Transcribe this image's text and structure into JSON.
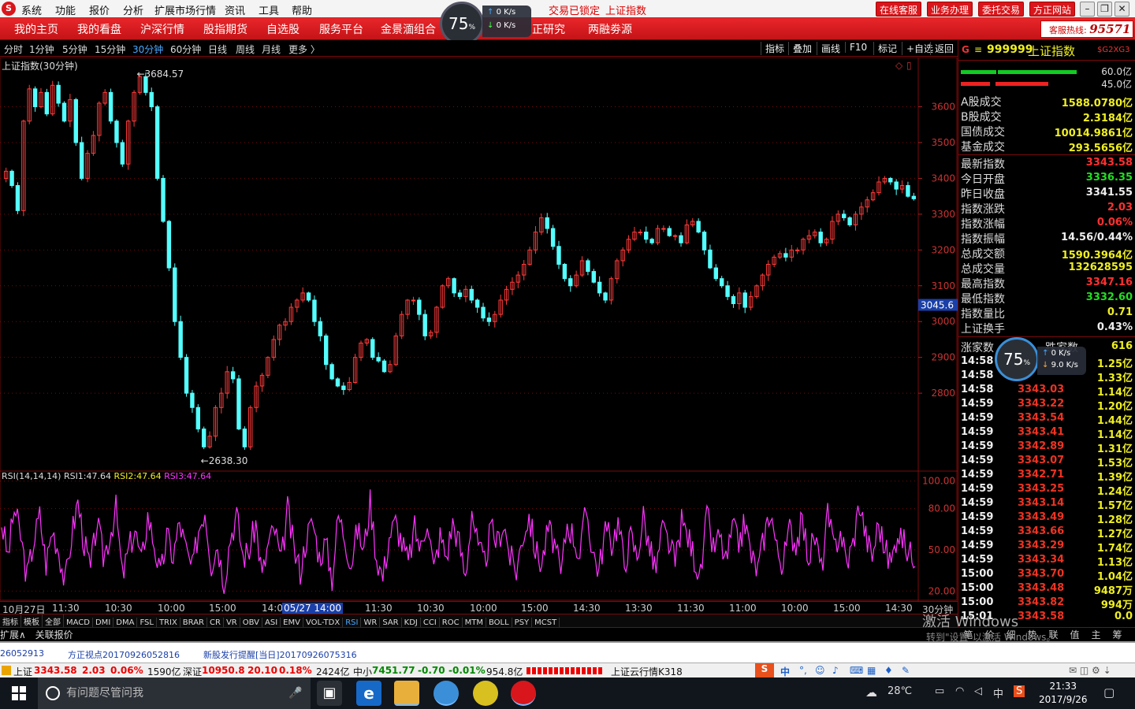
{
  "menubar": {
    "logo": "S",
    "items": [
      "系统",
      "功能",
      "报价",
      "分析",
      "扩展市场行情",
      "资讯",
      "工具",
      "帮助"
    ],
    "trade_lock": "交易已锁定",
    "current_index": "上证指数",
    "right_buttons": [
      "在线客服",
      "业务办理",
      "委托交易",
      "方正网站"
    ]
  },
  "gauge": {
    "percent": "75",
    "unit": "%",
    "up": "0 K/s",
    "down": "0 K/s"
  },
  "nav": {
    "items": [
      "我的主页",
      "我的看盘",
      "沪深行情",
      "股指期货",
      "自选股",
      "服务平台",
      "金景湎组合",
      "正研究",
      "两融劵源"
    ]
  },
  "hotline": {
    "label": "客服热线:",
    "number": "95571"
  },
  "periods": {
    "items": [
      "分时",
      "1分钟",
      "5分钟",
      "15分钟",
      "30分钟",
      "60分钟",
      "日线",
      "周线",
      "月线",
      "更多 〉"
    ],
    "active_index": 4,
    "tools": [
      "指标",
      "叠加",
      "画线",
      "F10",
      "标记",
      "+自选",
      "返回"
    ]
  },
  "chart_title": "上证指数(30分钟)",
  "chart_data": [
    {
      "type": "line",
      "name": "上证指数(30分钟)",
      "ylim": [
        2600,
        3720
      ],
      "yticks": [
        2800,
        2900,
        3000,
        3100,
        3200,
        3300,
        3400,
        3500,
        3600
      ],
      "annotations": {
        "high": "3684.57",
        "low": "2638.30",
        "cursor_price": "3045.6"
      },
      "series": [
        {
          "values": [
            3420,
            3380,
            3310,
            3560,
            3650,
            3600,
            3640,
            3580,
            3660,
            3610,
            3560,
            3620,
            3500,
            3400,
            3470,
            3520,
            3610,
            3640,
            3560,
            3500,
            3440,
            3560,
            3640,
            3684,
            3640,
            3600,
            3400,
            3280,
            3150,
            3000,
            2900,
            2800,
            2760,
            2700,
            2650,
            2680,
            2760,
            2800,
            2860,
            2840,
            2700,
            2650,
            2760,
            2820,
            2850,
            2900,
            2950,
            2990,
            3000,
            3040,
            3060,
            3080,
            3060,
            3000,
            2960,
            2880,
            2840,
            2820,
            2810,
            2830,
            2900,
            2940,
            2950,
            2900,
            2890,
            2860,
            2880,
            2960,
            3020,
            3060,
            3060,
            3020,
            2960,
            2970,
            3040,
            3100,
            3120,
            3080,
            3070,
            3090,
            3060,
            3040,
            3010,
            3000,
            3020,
            3060,
            3090,
            3110,
            3130,
            3160,
            3200,
            3250,
            3290,
            3260,
            3210,
            3160,
            3120,
            3100,
            3130,
            3170,
            3140,
            3110,
            3080,
            3060,
            3120,
            3170,
            3200,
            3230,
            3250,
            3250,
            3230,
            3220,
            3260,
            3260,
            3240,
            3240,
            3220,
            3270,
            3280,
            3250,
            3200,
            3150,
            3120,
            3100,
            3070,
            3050,
            3080,
            3040,
            3070,
            3100,
            3130,
            3160,
            3180,
            3190,
            3180,
            3200,
            3200,
            3230,
            3240,
            3250,
            3220,
            3230,
            3280,
            3300,
            3290,
            3270,
            3300,
            3320,
            3340,
            3360,
            3390,
            3400,
            3390,
            3370,
            3380,
            3350,
            3343
          ]
        }
      ]
    },
    {
      "type": "line",
      "name": "RSI(14,14,14)",
      "ylim": [
        15,
        105
      ],
      "yticks": [
        20,
        50,
        80,
        100
      ],
      "ytick_labels": [
        "20.00",
        "50.00",
        "80.00",
        "100.00"
      ],
      "series": [
        {
          "name": "RSI1",
          "values": [
            70,
            45,
            80,
            60,
            30,
            55,
            75,
            40,
            65,
            50,
            25,
            60,
            85,
            55,
            35,
            70,
            45,
            60,
            80,
            30,
            50,
            65,
            40,
            75,
            55,
            30,
            60,
            45,
            70,
            50,
            35,
            65,
            80,
            40,
            55,
            25,
            60,
            75,
            45,
            50,
            70,
            30,
            55,
            65,
            40,
            80,
            50,
            35,
            60,
            70,
            45,
            55,
            30,
            75,
            60,
            40,
            65,
            50,
            85,
            45,
            30,
            60,
            70,
            55,
            40,
            65,
            50,
            75,
            35,
            60,
            45,
            70,
            55,
            30,
            80,
            50,
            40,
            65,
            55,
            70,
            45,
            35,
            60,
            75,
            50,
            40,
            65,
            55,
            30,
            70,
            60,
            45,
            80,
            50,
            35,
            65,
            55,
            70,
            40,
            60,
            45,
            75,
            50,
            35,
            65,
            55,
            40,
            70,
            60,
            45,
            30,
            75,
            50,
            60,
            40,
            65,
            55,
            70,
            45,
            35,
            60,
            80,
            50,
            40,
            65,
            55,
            70,
            45,
            60,
            35,
            75,
            50,
            65,
            40,
            55,
            85,
            60,
            45,
            70,
            50,
            40,
            65,
            55,
            47
          ]
        }
      ]
    }
  ],
  "legend": {
    "rsi_title": "RSI(14,14,14)",
    "rsi1_label": "RSI1:",
    "rsi1_value": "47.64",
    "rsi2_label": "RSI2:",
    "rsi2_value": "47.64",
    "rsi3_label": "RSI3:",
    "rsi3_value": "47.64",
    "axis_unit": "30分钟"
  },
  "time_axis": [
    "10月27日",
    "11:30",
    "10:30",
    "10:00",
    "15:00",
    "14:00",
    "05/27 14:00",
    "11:30",
    "10:30",
    "10:00",
    "15:00",
    "14:30",
    "13:30",
    "11:30",
    "11:00",
    "10:00",
    "15:00",
    "14:30"
  ],
  "indicators": {
    "items": [
      "指标",
      "模板",
      "全部",
      "MACD",
      "DMI",
      "DMA",
      "FSL",
      "TRIX",
      "BRAR",
      "CR",
      "VR",
      "OBV",
      "ASI",
      "EMV",
      "VOL-TDX",
      "RSI",
      "WR",
      "SAR",
      "KDJ",
      "CCI",
      "ROC",
      "MTM",
      "BOLL",
      "PSY",
      "MCST"
    ],
    "active": "RSI"
  },
  "ext": {
    "expand": "扩展∧",
    "related": "关联报价"
  },
  "news": [
    "26052913",
    "方正视点20170926052816",
    "新股发行提醒[当日]20170926075316"
  ],
  "status": {
    "sh_label": "上证",
    "sh_price": "3343.58",
    "sh_chg": "2.03",
    "sh_pct": "0.06%",
    "sh_amt": "1590亿",
    "sz_label": "深证",
    "sz_price": "10950.8",
    "sz_chg": "20.10",
    "sz_pct": "0.18%",
    "sz_amt": "2424亿",
    "zx_label": "中小",
    "zx_price": "7451.77",
    "zx_chg": "-0.70",
    "zx_pct": "-0.01%",
    "zx_amt": "954.8亿",
    "cloud": "上证云行情K318"
  },
  "right_panel": {
    "code": "999999",
    "name": "上证指数",
    "tag": "$G2XG3",
    "bar1_pct": "60.0亿",
    "bar2_pct": "45.0亿",
    "volumes": [
      {
        "label": "A股成交",
        "value": "1588.0780亿"
      },
      {
        "label": "B股成交",
        "value": "2.3184亿"
      },
      {
        "label": "国债成交",
        "value": "10014.9861亿"
      },
      {
        "label": "基金成交",
        "value": "293.5656亿"
      }
    ],
    "stats": [
      {
        "label": "最新指数",
        "value": "3343.58",
        "color": "#ff3030"
      },
      {
        "label": "今日开盘",
        "value": "3336.35",
        "color": "#22dd22"
      },
      {
        "label": "昨日收盘",
        "value": "3341.55",
        "color": "#eeeeee"
      },
      {
        "label": "指数涨跌",
        "value": "2.03",
        "color": "#ff3030"
      },
      {
        "label": "指数涨幅",
        "value": "0.06%",
        "color": "#ff3030"
      },
      {
        "label": "指数振幅",
        "value": "14.56/0.44%",
        "color": "#eeeeee"
      },
      {
        "label": "总成交额",
        "value": "1590.3964亿",
        "color": "#eeee22"
      },
      {
        "label": "总成交量",
        "value": "132628595",
        "color": "#eeee22"
      },
      {
        "label": "最高指数",
        "value": "3347.16",
        "color": "#ff3030"
      },
      {
        "label": "最低指数",
        "value": "3332.60",
        "color": "#22dd22"
      },
      {
        "label": "指数量比",
        "value": "0.71",
        "color": "#eeee22"
      },
      {
        "label": "上证换手",
        "value": "0.43%",
        "color": "#eeeeee"
      }
    ],
    "updown": {
      "up_label": "涨家数",
      "down_label": "跌家数",
      "value": "616"
    },
    "ticks": [
      {
        "t": "14:58",
        "p": "",
        "v": "1.25亿"
      },
      {
        "t": "14:58",
        "p": "",
        "v": "1.33亿"
      },
      {
        "t": "14:58",
        "p": "3343.03",
        "v": "1.14亿"
      },
      {
        "t": "14:59",
        "p": "3343.22",
        "v": "1.20亿"
      },
      {
        "t": "14:59",
        "p": "3343.54",
        "v": "1.44亿"
      },
      {
        "t": "14:59",
        "p": "3343.41",
        "v": "1.14亿"
      },
      {
        "t": "14:59",
        "p": "3342.89",
        "v": "1.31亿"
      },
      {
        "t": "14:59",
        "p": "3343.07",
        "v": "1.53亿"
      },
      {
        "t": "14:59",
        "p": "3342.71",
        "v": "1.39亿"
      },
      {
        "t": "14:59",
        "p": "3343.25",
        "v": "1.24亿"
      },
      {
        "t": "14:59",
        "p": "3343.14",
        "v": "1.57亿"
      },
      {
        "t": "14:59",
        "p": "3343.49",
        "v": "1.28亿"
      },
      {
        "t": "14:59",
        "p": "3343.66",
        "v": "1.27亿"
      },
      {
        "t": "14:59",
        "p": "3343.29",
        "v": "1.74亿"
      },
      {
        "t": "14:59",
        "p": "3343.34",
        "v": "1.13亿"
      },
      {
        "t": "15:00",
        "p": "3343.70",
        "v": "1.04亿"
      },
      {
        "t": "15:00",
        "p": "3343.48",
        "v": "9487万"
      },
      {
        "t": "15:00",
        "p": "3343.82",
        "v": "994万"
      },
      {
        "t": "15:01",
        "p": "3343.58",
        "v": "0.0"
      }
    ],
    "tabs": [
      "笔",
      "价",
      "细",
      "势",
      "联",
      "值",
      "主",
      "筹"
    ]
  },
  "gauge2": {
    "percent": "75",
    "unit": "%",
    "up": "0 K/s",
    "down": "9.0 K/s"
  },
  "activation": {
    "line1": "激活 Windows",
    "line2": "转到\"设置\"以激活 Windows。"
  },
  "ime": {
    "label": "中"
  },
  "taskbar": {
    "search_placeholder": "有问题尽管问我",
    "weather": "28℃",
    "ime": "中",
    "time": "21:33",
    "date": "2017/9/26"
  },
  "colors": {
    "candle_up": "#ff3b3b",
    "candle_down": "#54ffff",
    "rsi": "#ff33ff",
    "grid_red": "#7a0a0a"
  }
}
